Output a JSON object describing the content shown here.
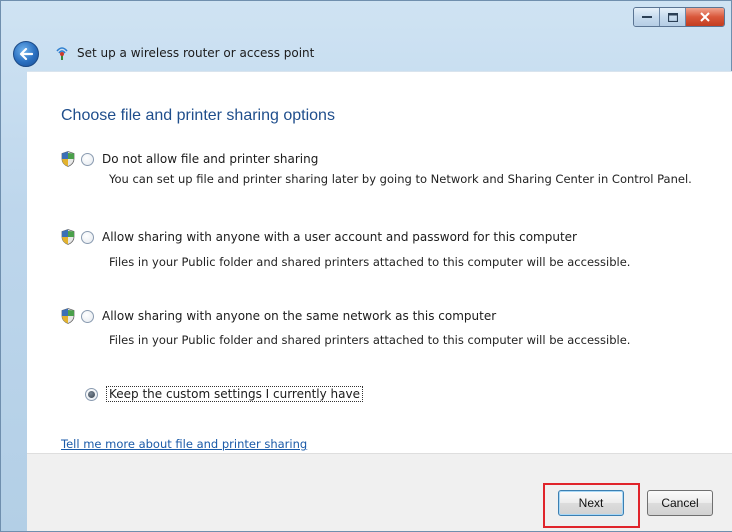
{
  "window": {
    "title": "Set up a wireless router or access point"
  },
  "page": {
    "heading": "Choose file and printer sharing options"
  },
  "options": [
    {
      "label": "Do not allow file and printer sharing",
      "description": "You can set up file and printer sharing later by going to Network and Sharing Center in Control Panel."
    },
    {
      "label": "Allow sharing with anyone with a user account and password for this computer",
      "description": "Files in your Public folder and shared printers attached to this computer will be accessible."
    },
    {
      "label": "Allow sharing with anyone on the same network as this computer",
      "description": "Files in your Public folder and shared printers attached to this computer will be accessible."
    }
  ],
  "custom_option": {
    "label": "Keep the custom settings I currently have",
    "selected": true
  },
  "help_link": "Tell me more about file and printer sharing",
  "buttons": {
    "next": "Next",
    "cancel": "Cancel"
  },
  "colors": {
    "heading": "#1f4e8c",
    "link": "#1a5aa8",
    "highlight": "#e0242b"
  },
  "icons": {
    "back": "back-arrow-icon",
    "wizard": "wireless-network-icon",
    "shield": "uac-shield-icon"
  }
}
